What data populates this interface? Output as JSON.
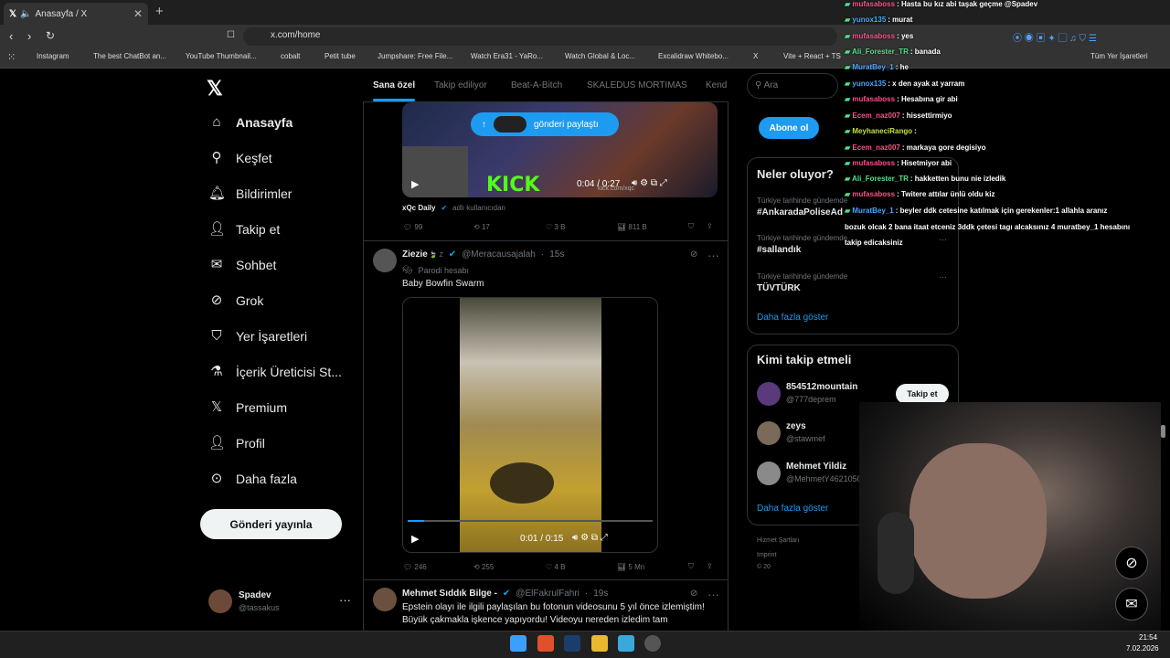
{
  "browser": {
    "tab_title": "Anasayfa / X",
    "url": "x.com/home",
    "bookmarks": [
      "Instagram",
      "The best ChatBot an...",
      "YouTube Thumbnail...",
      "cobalt",
      "Petit tube",
      "Jumpshare: Free File...",
      "Watch Era31 - YaRo...",
      "Watch Global & Loc...",
      "Excalidraw Whitebo...",
      "X",
      "Vite + React + TS",
      "file.io - Super simpl...",
      "hitbox.io - Official Si..."
    ],
    "all_bookmarks": "Tüm Yer İşaretleri"
  },
  "nav": {
    "items": [
      "Anasayfa",
      "Keşfet",
      "Bildirimler",
      "Takip et",
      "Sohbet",
      "Grok",
      "Yer İşaretleri",
      "İçerik Üreticisi St...",
      "Premium",
      "Profil",
      "Daha fazla"
    ],
    "post_button": "Gönderi yayınla",
    "account_name": "Spadev",
    "account_handle": "@tassakus"
  },
  "feed": {
    "tabs": [
      "Sana özel",
      "Takip ediliyor",
      "Beat-A-Bitch",
      "SKALEDUS MORTIMAS",
      "Kend"
    ],
    "toast": "gönderi paylaştı",
    "video1": {
      "time": "0:04 / 0:27",
      "overlay_text": "KICK",
      "watermark": "kick.com/xqc",
      "source_name": "xQc Daily",
      "source_note": "adlı kullanıcıdan",
      "replies": "99",
      "reposts": "17",
      "likes": "3 B",
      "views": "811 B"
    },
    "post2": {
      "name": "Ziezie",
      "sup": "🍃 Z",
      "handle": "@Meracausajalah",
      "time": "15s",
      "badge": "Parodi hesabı",
      "text": "Baby Bowfin Swarm",
      "video_time": "0:01 / 0:15",
      "replies": "246",
      "reposts": "255",
      "likes": "4 B",
      "views": "5 Mn"
    },
    "post3": {
      "name": "Mehmet Sıddık Bilge -",
      "handle": "@ElFakrulFahri",
      "time": "19s",
      "text1": "Epstein olayı ile ilgili paylaşılan bu fotonun videosunu 5 yıl önce izlemiştim!",
      "text2": "Büyük çakmakla işkence yapıyordu! Videoyu nereden izledim tam"
    }
  },
  "right": {
    "search_placeholder": "Ara",
    "subscribe": "Abone ol",
    "trending_title": "Neler oluyor?",
    "trends": [
      {
        "context": "Türkiye tarihinde gündemde",
        "name": "#AnkaradaPoliseAd"
      },
      {
        "context": "Türkiye tarihinde gündemde",
        "name": "#sallandık"
      },
      {
        "context": "Türkiye tarihinde gündemde",
        "name": "TÜVTÜRK"
      }
    ],
    "show_more": "Daha fazla göster",
    "follow_title": "Kimi takip etmeli",
    "follow": [
      {
        "name": "854512mountain",
        "handle": "@777deprem"
      },
      {
        "name": "zeys",
        "handle": "@stawmef"
      },
      {
        "name": "Mehmet Yildiz",
        "handle": "@MehmetY46210505"
      }
    ],
    "follow_button": "Takip et",
    "footer": [
      "Hizmet Şartları",
      "Imprint",
      "© 20"
    ]
  },
  "chat": [
    {
      "user": "mufasaboss",
      "color": "#ff4f8b",
      "msg": "Hasta bu kız abi taşak geçme @Spadev"
    },
    {
      "user": "yunox135",
      "color": "#4fa3ff",
      "msg": "murat"
    },
    {
      "user": "mufasaboss",
      "color": "#ff4f8b",
      "msg": "yes"
    },
    {
      "user": "Ali_Forester_TR",
      "color": "#4fe08a",
      "msg": "banada"
    },
    {
      "user": "MuratBey_1",
      "color": "#4fa3ff",
      "msg": "he"
    },
    {
      "user": "yunox135",
      "color": "#4fa3ff",
      "msg": "x den ayak at yarram"
    },
    {
      "user": "mufasaboss",
      "color": "#ff4f8b",
      "msg": "Hesabına gir abi"
    },
    {
      "user": "Ecem_naz007",
      "color": "#ff4f8b",
      "msg": "hissettirmiyo"
    },
    {
      "user": "MeyhaneciRango",
      "color": "#c0e040",
      "msg": ""
    },
    {
      "user": "Ecem_naz007",
      "color": "#ff4f8b",
      "msg": "markaya gore degisiyo"
    },
    {
      "user": "mufasaboss",
      "color": "#ff4f8b",
      "msg": "Hisetmiyor abi"
    },
    {
      "user": "Ali_Forester_TR",
      "color": "#4fe08a",
      "msg": "hakketten bunu nie izledik"
    },
    {
      "user": "mufasaboss",
      "color": "#ff4f8b",
      "msg": "Twitere attılar ünlü oldu kiz"
    },
    {
      "user": "MuratBey_1",
      "color": "#4fa3ff",
      "msg": "beyler ddk cetesine katılmak için gerekenler:1 allahla aranız"
    },
    {
      "user": "",
      "color": "#fff",
      "msg": "bozuk olcak 2 bana itaat etceniz 3ddk çetesi tagı alcaksınız 4 muratbey_1 hesabını"
    },
    {
      "user": "",
      "color": "#fff",
      "msg": "takip edicaksiniz"
    }
  ],
  "clock": {
    "time": "21:54",
    "date": "7.02.2026"
  },
  "colors": {
    "accent": "#1d9bf0",
    "bg": "#000000",
    "border": "#2f3336"
  }
}
